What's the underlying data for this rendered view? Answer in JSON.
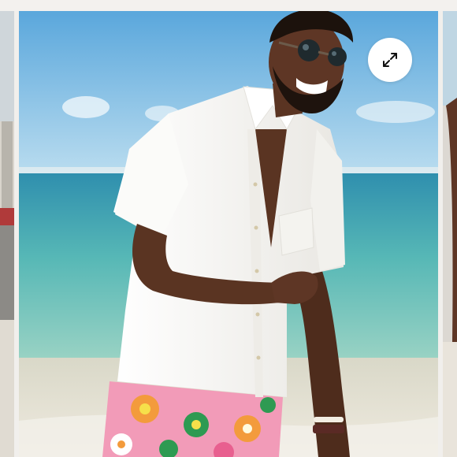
{
  "gallery": {
    "main_image": {
      "subject": "product-photo",
      "colors": {
        "sky": "#6fb4df",
        "ocean": "#4fb0b2",
        "sand": "#e6dfcf",
        "shirt": "#f7f6f3",
        "skin": "#5a3422",
        "shorts_pink": "#f29bb8",
        "shorts_orange": "#f39b3c",
        "shorts_green": "#2e9a52"
      }
    },
    "expand_button": {
      "icon": "expand-arrows-icon",
      "color": "#111111",
      "background": "#ffffff"
    },
    "background": "#f1efec"
  }
}
